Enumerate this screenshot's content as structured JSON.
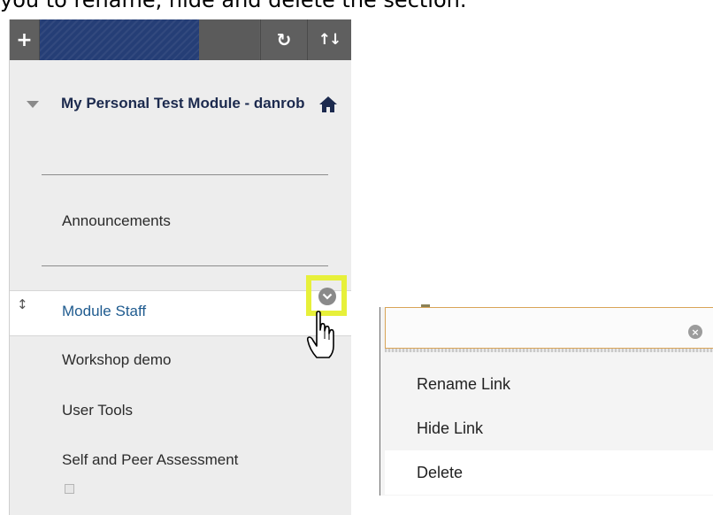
{
  "caption": "you to rename, hide and delete the section.",
  "toolbar": {
    "add_symbol": "+",
    "refresh_symbol": "↻",
    "sort_symbol": "↑↓"
  },
  "course": {
    "title": "My Personal Test Module - danrob"
  },
  "menu": {
    "items": [
      {
        "label": "Announcements"
      },
      {
        "label": "Module Staff"
      },
      {
        "label": "Workshop demo"
      },
      {
        "label": "User Tools"
      },
      {
        "label": "Self and Peer Assessment"
      }
    ],
    "active_index": 1
  },
  "context_menu": {
    "items": [
      {
        "label": "Rename Link"
      },
      {
        "label": "Hide Link"
      },
      {
        "label": "Delete"
      }
    ],
    "close_symbol": "×"
  },
  "colors": {
    "highlight": "#e7f03a",
    "brand": "#253e76",
    "toolbar": "#5f5f5f",
    "active_link": "#1f5b8f"
  }
}
